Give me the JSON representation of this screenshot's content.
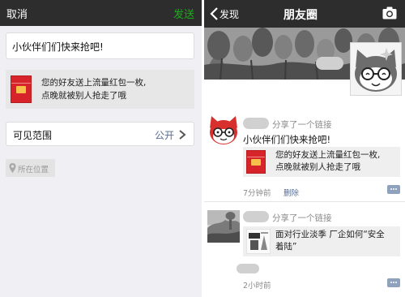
{
  "compose": {
    "cancel_label": "取消",
    "send_label": "发送",
    "post_text": "小伙伴们们快来抢吧!",
    "share_message_line1": "您的好友送上流量红包一枚,",
    "share_message_line2": "点晚就被别人抢走了哦",
    "visibility_label": "可见范围",
    "visibility_value": "公开",
    "location_label": "所在位置"
  },
  "moments": {
    "back_label": "发现",
    "title": "朋友圈",
    "posts": [
      {
        "action": "分享了一个链接",
        "text": "小伙伴们们快来抢吧!",
        "card_line1": "您的好友送上流量红包一枚,",
        "card_line2": "点晚就被别人抢走了哦",
        "time": "7分钟前",
        "delete_label": "删除"
      },
      {
        "action": "分享了一个链接",
        "card_line1": "面对行业淡季 厂企如何“安全",
        "card_line2": "着陆”",
        "time": "2小时前"
      }
    ]
  },
  "colors": {
    "titlebar": "#2d2d2d",
    "send_green": "#1aad19",
    "link_blue": "#576b95",
    "red_packet": "#d6242a"
  }
}
